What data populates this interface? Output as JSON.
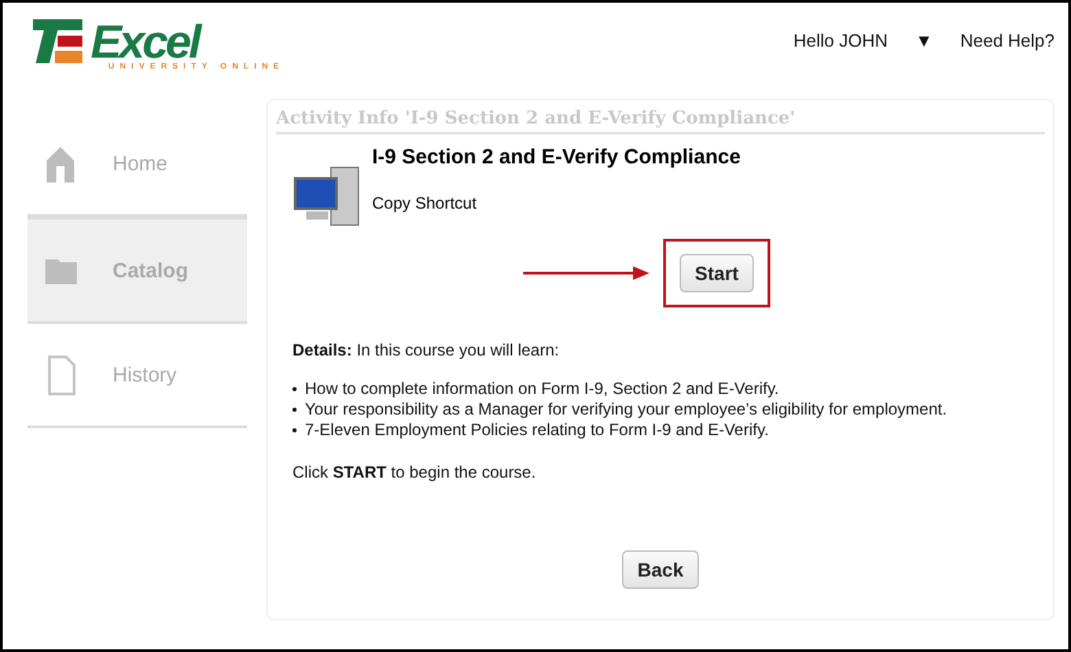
{
  "header": {
    "logo": {
      "word": "Excel",
      "tagline": "UNIVERSITY ONLINE"
    },
    "greeting": "Hello JOHN",
    "menu_caret": "▼",
    "help": "Need Help?"
  },
  "sidebar": {
    "items": [
      {
        "label": "Home",
        "kind": "home",
        "selected": false
      },
      {
        "label": "Catalog",
        "kind": "catalog",
        "selected": true
      },
      {
        "label": "History",
        "kind": "history",
        "selected": false
      }
    ]
  },
  "panel": {
    "title": "Activity Info 'I-9 Section 2 and E-Verify Compliance'",
    "course_title": "I-9 Section 2 and E-Verify Compliance",
    "shortcut": "Copy Shortcut",
    "start_button": "Start",
    "start_highlighted": true,
    "details": "**Details:** In this course you will learn:",
    "bullets": [
      "How to complete information on Form I-9, Section 2 and E-Verify.",
      "Your responsibility as a Manager for verifying your employee’s eligibility for employment.",
      "7-Eleven Employment Policies relating to Form I-9 and E-Verify."
    ],
    "instruction": "Click **START** to begin the course.",
    "back_button": "Back"
  }
}
